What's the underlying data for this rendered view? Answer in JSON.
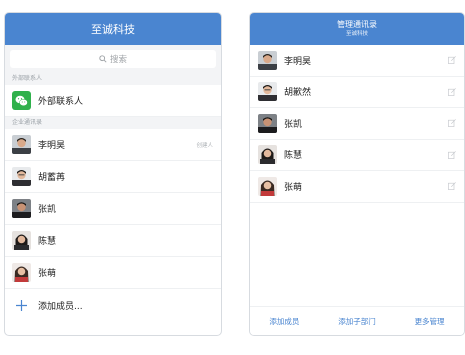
{
  "left": {
    "header_title": "至诚科技",
    "search_placeholder": "搜索",
    "external_section": "外部联系人",
    "external_item": "外部联系人",
    "company_section": "企业通讯录",
    "members": [
      {
        "name": "李明昊",
        "meta": "创建人"
      },
      {
        "name": "胡蓄苒",
        "meta": ""
      },
      {
        "name": "张凯",
        "meta": ""
      },
      {
        "name": "陈慧",
        "meta": ""
      },
      {
        "name": "张萌",
        "meta": ""
      }
    ],
    "add_member": "添加成员..."
  },
  "right": {
    "header_title": "管理通讯录",
    "header_subtitle": "至诚科技",
    "members": [
      {
        "name": "李明昊"
      },
      {
        "name": "胡歉然"
      },
      {
        "name": "张凯"
      },
      {
        "name": "陈慧"
      },
      {
        "name": "张萌"
      }
    ],
    "footer": {
      "add_member": "添加成员",
      "add_subdept": "添加子部门",
      "more_manage": "更多管理"
    }
  },
  "colors": {
    "header_bg": "#4a85d0",
    "accent": "#4a85d0",
    "wechat_green": "#2fb14b"
  },
  "icons": [
    "search-icon",
    "wechat-icon",
    "plus-icon",
    "edit-icon"
  ]
}
